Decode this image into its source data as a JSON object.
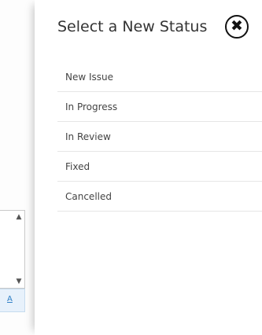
{
  "modal": {
    "title": "Select a New Status",
    "close_symbol": "✖",
    "statuses": [
      {
        "label": "New Issue"
      },
      {
        "label": "In Progress"
      },
      {
        "label": "In Review"
      },
      {
        "label": "Fixed"
      },
      {
        "label": "Cancelled"
      }
    ]
  },
  "background": {
    "scroll_up_icon": "chevron-up-icon",
    "scroll_down_icon": "chevron-down-icon",
    "format_button_glyph": "A"
  }
}
